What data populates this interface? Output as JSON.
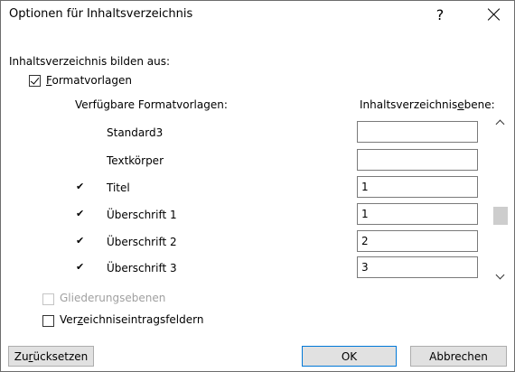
{
  "dialog": {
    "title": "Optionen für Inhaltsverzeichnis",
    "help_label": "?",
    "section_label": "Inhaltsverzeichnis bilden aus:"
  },
  "formatvorlagen": {
    "checked": true,
    "mnemonic": "F",
    "rest": "ormatvorlagen"
  },
  "columns": {
    "available": "Verfügbare Formatvorlagen:",
    "level_before": "Inhaltsverzeichnis",
    "level_mnemonic": "e",
    "level_after": "bene:"
  },
  "styles": [
    {
      "name": "Standard3",
      "checked": false,
      "check_mark": "",
      "level": ""
    },
    {
      "name": "Textkörper",
      "checked": false,
      "check_mark": "",
      "level": ""
    },
    {
      "name": "Titel",
      "checked": true,
      "check_mark": "✔",
      "level": "1"
    },
    {
      "name": "Überschrift 1",
      "checked": true,
      "check_mark": "✔",
      "level": "1"
    },
    {
      "name": "Überschrift 2",
      "checked": true,
      "check_mark": "✔",
      "level": "2"
    },
    {
      "name": "Überschrift 3",
      "checked": true,
      "check_mark": "✔",
      "level": "3"
    }
  ],
  "gliederung": {
    "label": "Gliederungsebenen",
    "checked": false,
    "enabled": false
  },
  "verzeichnis": {
    "before": "Ver",
    "mnemonic": "z",
    "after": "eichniseintragsfeldern",
    "checked": false
  },
  "buttons": {
    "reset_before": "Zu",
    "reset_mnemonic": "r",
    "reset_after": "ücksetzen",
    "ok": "OK",
    "cancel": "Abbrechen"
  },
  "colors": {
    "ok_border": "#0078d7",
    "button_bg": "#e1e1e1",
    "disabled_text": "#a0a0a0"
  }
}
